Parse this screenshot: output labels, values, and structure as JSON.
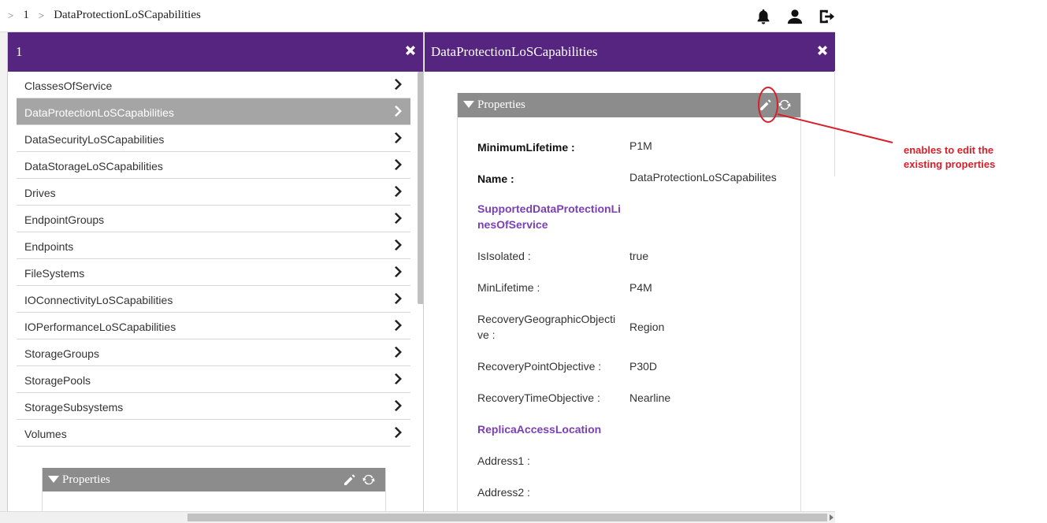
{
  "breadcrumb": {
    "items": [
      "1",
      "DataProtectionLoSCapabilities"
    ],
    "separator": ">"
  },
  "top_icons": [
    "bell-icon",
    "user-icon",
    "logout-icon"
  ],
  "left_panel": {
    "title": "1",
    "items": [
      "ClassesOfService",
      "DataProtectionLoSCapabilities",
      "DataSecurityLoSCapabilities",
      "DataStorageLoSCapabilities",
      "Drives",
      "EndpointGroups",
      "Endpoints",
      "FileSystems",
      "IOConnectivityLoSCapabilities",
      "IOPerformanceLoSCapabilities",
      "StorageGroups",
      "StoragePools",
      "StorageSubsystems",
      "Volumes"
    ],
    "active_index": 1,
    "properties_title": "Properties"
  },
  "right_panel": {
    "title": "DataProtectionLoSCapabilities",
    "properties_title": "Properties",
    "rows": [
      {
        "key": "MinimumLifetime :",
        "value": "P1M"
      },
      {
        "key": "Name :",
        "value": "DataProtectionLoSCapabilites"
      },
      {
        "section": "SupportedDataProtectionLinesOfService"
      },
      {
        "key": "IsIsolated :",
        "value": "true"
      },
      {
        "key": "MinLifetime :",
        "value": "P4M"
      },
      {
        "key": "RecoveryGeographicObjective :",
        "value": "Region"
      },
      {
        "key": "RecoveryPointObjective :",
        "value": "P30D"
      },
      {
        "key": "RecoveryTimeObjective :",
        "value": "Nearline"
      },
      {
        "section": "ReplicaAccessLocation"
      },
      {
        "key": "Address1 :",
        "value": ""
      },
      {
        "key": "Address2 :",
        "value": ""
      }
    ]
  },
  "annotation": {
    "line1": "enables to edit the",
    "line2": "existing properties",
    "color": "#d6202a"
  },
  "colors": {
    "header_purple": "#55257f",
    "active_item": "#a5a5a5",
    "section_purple": "#7a3fb5",
    "properties_header": "#8c8c8c"
  }
}
